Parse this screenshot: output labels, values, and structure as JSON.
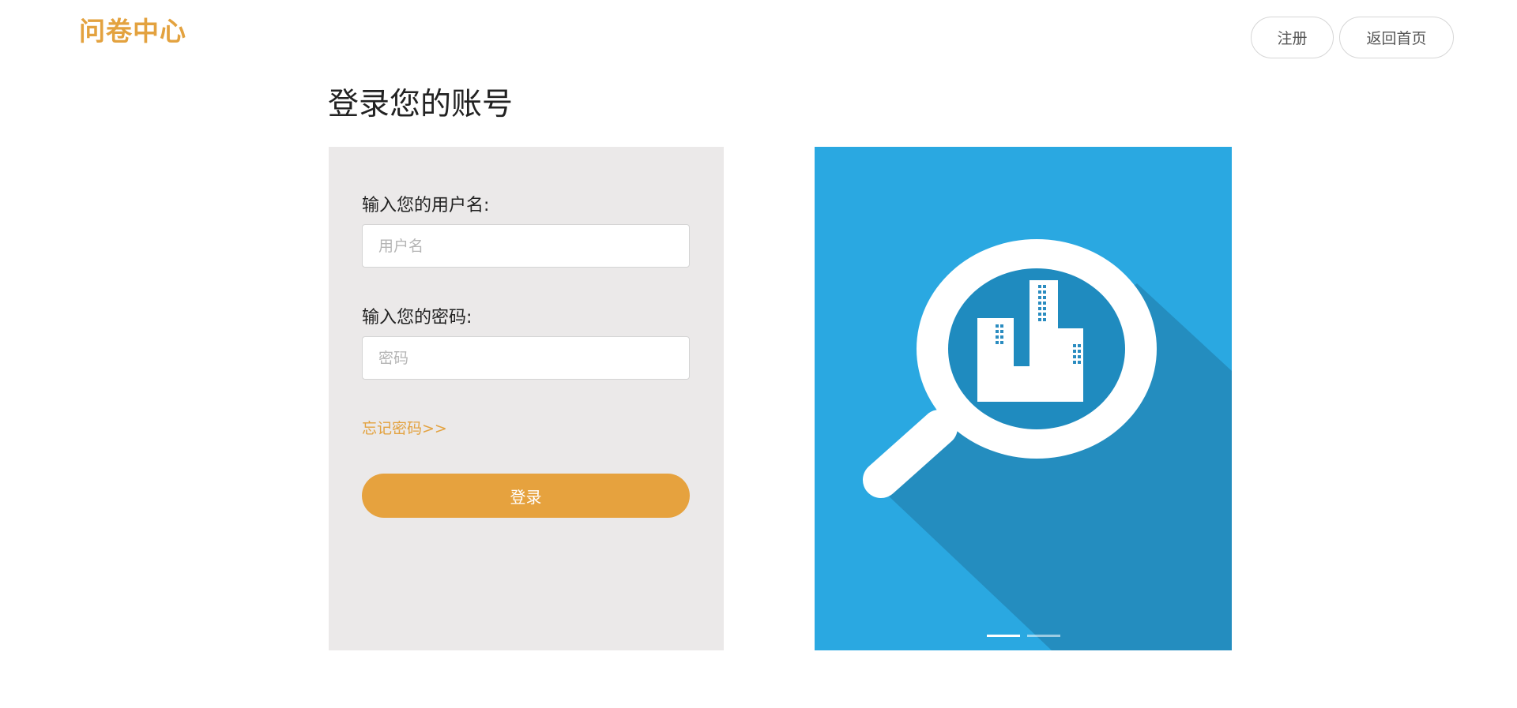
{
  "header": {
    "logo": "问卷中心",
    "register_label": "注册",
    "home_label": "返回首页"
  },
  "page_title": "登录您的账号",
  "form": {
    "username_label": "输入您的用户名:",
    "username_placeholder": "用户名",
    "password_label": "输入您的密码:",
    "password_placeholder": "密码",
    "forgot_label": "忘记密码>>",
    "login_label": "登录"
  },
  "carousel": {
    "slide_icon": "magnifier-buildings-icon",
    "active_slide": 1,
    "slide_count": 2,
    "background_color": "#2aa8e1"
  },
  "colors": {
    "accent": "#e6a23e",
    "panel": "#ebe9e9"
  }
}
